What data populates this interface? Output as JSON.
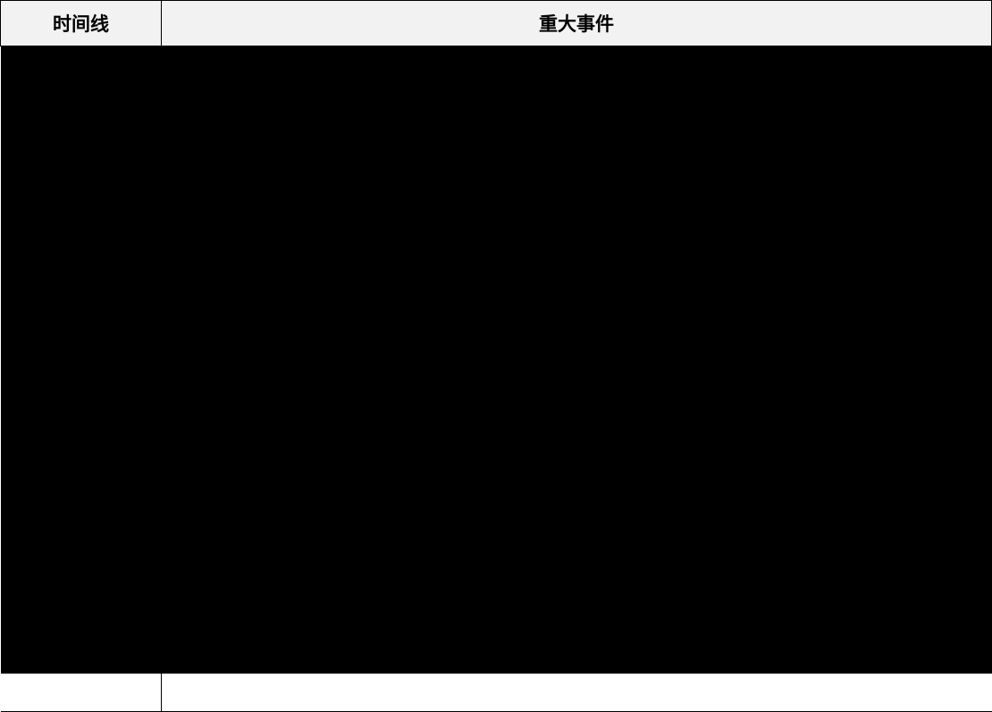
{
  "table": {
    "headers": {
      "timeline": "时间线",
      "event": "重大事件"
    }
  }
}
